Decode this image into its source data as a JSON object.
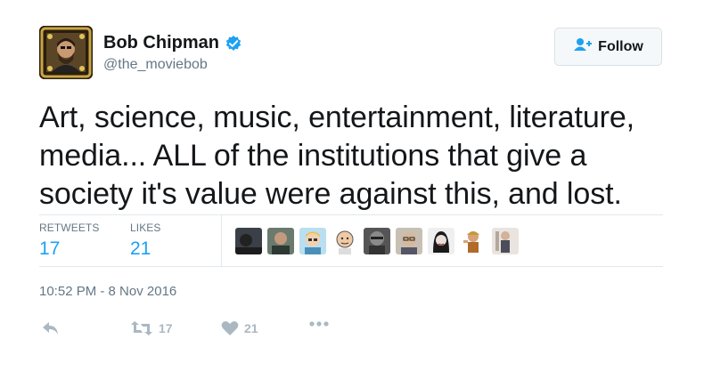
{
  "author": {
    "display_name": "Bob Chipman",
    "handle": "@the_moviebob",
    "verified_icon": "verified-badge-icon"
  },
  "follow_button": {
    "label": "Follow",
    "icon": "add-user-icon"
  },
  "tweet": {
    "text": "Art, science, music, entertainment, literature, media... ALL of the institutions that give a society it's value were against this, and lost."
  },
  "stats": {
    "retweets_label": "RETWEETS",
    "retweets_value": "17",
    "likes_label": "LIKES",
    "likes_value": "21"
  },
  "timestamp": "10:52 PM - 8 Nov 2016",
  "actions": {
    "reply_icon": "reply-icon",
    "retweet_icon": "retweet-icon",
    "retweet_count": "17",
    "like_icon": "heart-icon",
    "like_count": "21",
    "more_icon": "more-icon"
  },
  "colors": {
    "link_blue": "#1da1f2",
    "muted_gray": "#657786",
    "icon_gray": "#aab8c2",
    "divider": "#e1e8ed"
  }
}
